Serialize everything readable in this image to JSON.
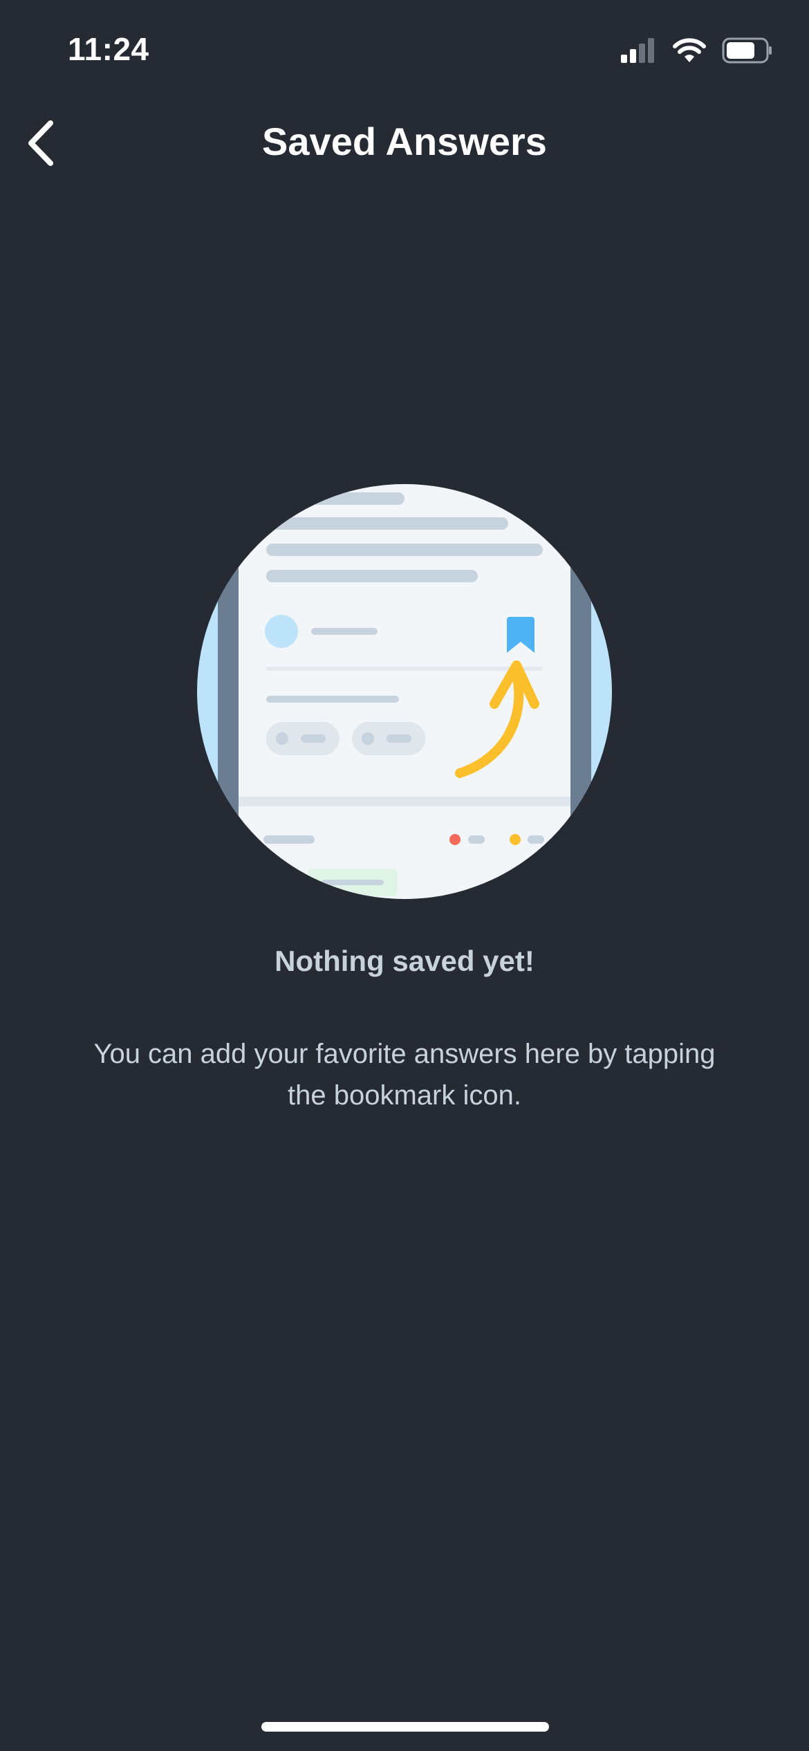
{
  "status_bar": {
    "time": "11:24",
    "icons": [
      "cellular-signal-icon",
      "wifi-icon",
      "battery-icon"
    ]
  },
  "nav": {
    "title": "Saved Answers",
    "back_icon": "chevron-left-icon"
  },
  "empty_state": {
    "illustration": "bookmark-illustration",
    "title": "Nothing saved yet!",
    "description": "You can add your favorite answers here by tapping the bookmark icon."
  },
  "colors": {
    "background": "#252a33",
    "text_muted": "#c8d2dc",
    "bookmark_accent": "#4db3f5",
    "arrow_accent": "#fbbf2c"
  }
}
